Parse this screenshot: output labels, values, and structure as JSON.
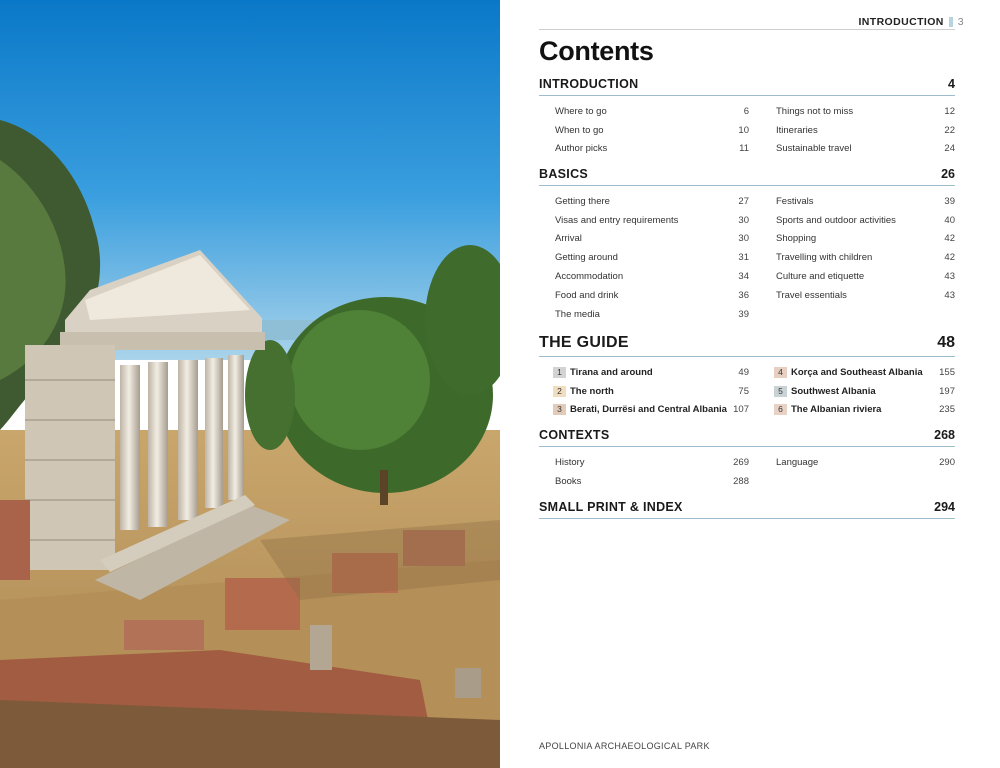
{
  "header": {
    "running_head": "INTRODUCTION",
    "page_number": "3"
  },
  "title": "Contents",
  "sections": {
    "introduction": {
      "title": "INTRODUCTION",
      "page": "4",
      "left": [
        {
          "t": "Where to go",
          "p": "6"
        },
        {
          "t": "When to go",
          "p": "10"
        },
        {
          "t": "Author picks",
          "p": "11"
        }
      ],
      "right": [
        {
          "t": "Things not to miss",
          "p": "12"
        },
        {
          "t": "Itineraries",
          "p": "22"
        },
        {
          "t": "Sustainable travel",
          "p": "24"
        }
      ]
    },
    "basics": {
      "title": "BASICS",
      "page": "26",
      "left": [
        {
          "t": "Getting there",
          "p": "27"
        },
        {
          "t": "Visas and entry requirements",
          "p": "30"
        },
        {
          "t": "Arrival",
          "p": "30"
        },
        {
          "t": "Getting around",
          "p": "31"
        },
        {
          "t": "Accommodation",
          "p": "34"
        },
        {
          "t": "Food and drink",
          "p": "36"
        },
        {
          "t": "The media",
          "p": "39"
        }
      ],
      "right": [
        {
          "t": "Festivals",
          "p": "39"
        },
        {
          "t": "Sports and outdoor activities",
          "p": "40"
        },
        {
          "t": "Shopping",
          "p": "42"
        },
        {
          "t": "Travelling with children",
          "p": "42"
        },
        {
          "t": "Culture and etiquette",
          "p": "43"
        },
        {
          "t": "Travel essentials",
          "p": "43"
        }
      ]
    },
    "guide": {
      "title": "THE GUIDE",
      "page": "48",
      "left": [
        {
          "n": "1",
          "t": "Tirana and around",
          "p": "49",
          "color": "#d3d3d3"
        },
        {
          "n": "2",
          "t": "The north",
          "p": "75",
          "color": "#f1ddc0"
        },
        {
          "n": "3",
          "t": "Berati, Durrësi and Central Albania",
          "p": "107",
          "color": "#e2cbb9"
        }
      ],
      "right": [
        {
          "n": "4",
          "t": "Korça and Southeast Albania",
          "p": "155",
          "color": "#e7cfc1"
        },
        {
          "n": "5",
          "t": "Southwest Albania",
          "p": "197",
          "color": "#c9d3d6"
        },
        {
          "n": "6",
          "t": "The Albanian riviera",
          "p": "235",
          "color": "#e8d2c6"
        }
      ]
    },
    "contexts": {
      "title": "CONTEXTS",
      "page": "268",
      "left": [
        {
          "t": "History",
          "p": "269"
        },
        {
          "t": "Books",
          "p": "288"
        }
      ],
      "right": [
        {
          "t": "Language",
          "p": "290"
        }
      ]
    },
    "small_print": {
      "title": "SMALL PRINT & INDEX",
      "page": "294"
    }
  },
  "caption": "APOLLONIA ARCHAEOLOGICAL PARK",
  "colors": {
    "rule": "#9dbccc",
    "accent_bar": "#b9d3df"
  }
}
